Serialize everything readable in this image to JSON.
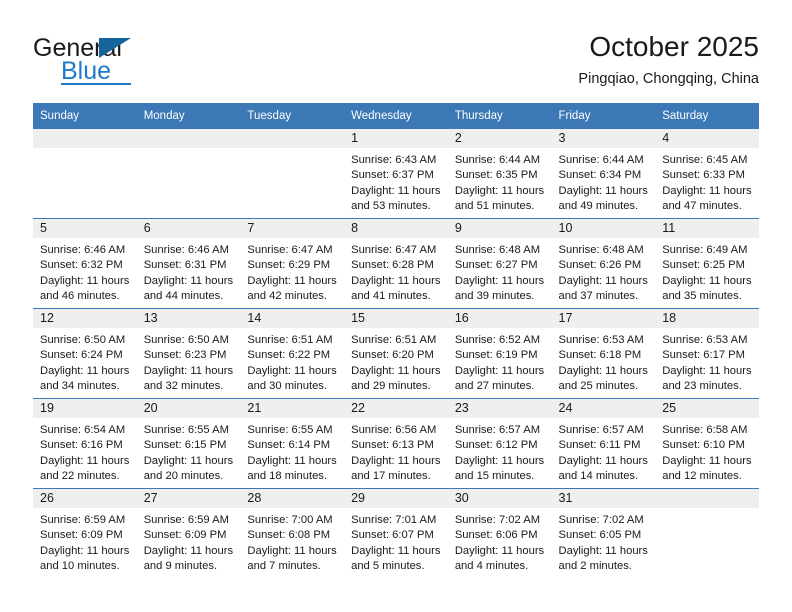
{
  "logo": {
    "word1": "General",
    "word2": "Blue",
    "triangle_color": "#16639e",
    "accent_color": "#1f7ac8"
  },
  "header": {
    "title": "October 2025",
    "subtitle": "Pingqiao, Chongqing, China",
    "header_bg": "#3b78b5",
    "daynum_bg": "#efefef"
  },
  "weekday_headers": [
    "Sunday",
    "Monday",
    "Tuesday",
    "Wednesday",
    "Thursday",
    "Friday",
    "Saturday"
  ],
  "labels": {
    "sunrise_prefix": "Sunrise: ",
    "sunset_prefix": "Sunset: ",
    "daylight_prefix": "Daylight: "
  },
  "weeks": [
    [
      {
        "day": "",
        "sunrise": "",
        "sunset": "",
        "daylight": "",
        "empty": true
      },
      {
        "day": "",
        "sunrise": "",
        "sunset": "",
        "daylight": "",
        "empty": true
      },
      {
        "day": "",
        "sunrise": "",
        "sunset": "",
        "daylight": "",
        "empty": true
      },
      {
        "day": "1",
        "sunrise": "Sunrise: 6:43 AM",
        "sunset": "Sunset: 6:37 PM",
        "daylight": "Daylight: 11 hours and 53 minutes.",
        "empty": false
      },
      {
        "day": "2",
        "sunrise": "Sunrise: 6:44 AM",
        "sunset": "Sunset: 6:35 PM",
        "daylight": "Daylight: 11 hours and 51 minutes.",
        "empty": false
      },
      {
        "day": "3",
        "sunrise": "Sunrise: 6:44 AM",
        "sunset": "Sunset: 6:34 PM",
        "daylight": "Daylight: 11 hours and 49 minutes.",
        "empty": false
      },
      {
        "day": "4",
        "sunrise": "Sunrise: 6:45 AM",
        "sunset": "Sunset: 6:33 PM",
        "daylight": "Daylight: 11 hours and 47 minutes.",
        "empty": false
      }
    ],
    [
      {
        "day": "5",
        "sunrise": "Sunrise: 6:46 AM",
        "sunset": "Sunset: 6:32 PM",
        "daylight": "Daylight: 11 hours and 46 minutes.",
        "empty": false
      },
      {
        "day": "6",
        "sunrise": "Sunrise: 6:46 AM",
        "sunset": "Sunset: 6:31 PM",
        "daylight": "Daylight: 11 hours and 44 minutes.",
        "empty": false
      },
      {
        "day": "7",
        "sunrise": "Sunrise: 6:47 AM",
        "sunset": "Sunset: 6:29 PM",
        "daylight": "Daylight: 11 hours and 42 minutes.",
        "empty": false
      },
      {
        "day": "8",
        "sunrise": "Sunrise: 6:47 AM",
        "sunset": "Sunset: 6:28 PM",
        "daylight": "Daylight: 11 hours and 41 minutes.",
        "empty": false
      },
      {
        "day": "9",
        "sunrise": "Sunrise: 6:48 AM",
        "sunset": "Sunset: 6:27 PM",
        "daylight": "Daylight: 11 hours and 39 minutes.",
        "empty": false
      },
      {
        "day": "10",
        "sunrise": "Sunrise: 6:48 AM",
        "sunset": "Sunset: 6:26 PM",
        "daylight": "Daylight: 11 hours and 37 minutes.",
        "empty": false
      },
      {
        "day": "11",
        "sunrise": "Sunrise: 6:49 AM",
        "sunset": "Sunset: 6:25 PM",
        "daylight": "Daylight: 11 hours and 35 minutes.",
        "empty": false
      }
    ],
    [
      {
        "day": "12",
        "sunrise": "Sunrise: 6:50 AM",
        "sunset": "Sunset: 6:24 PM",
        "daylight": "Daylight: 11 hours and 34 minutes.",
        "empty": false
      },
      {
        "day": "13",
        "sunrise": "Sunrise: 6:50 AM",
        "sunset": "Sunset: 6:23 PM",
        "daylight": "Daylight: 11 hours and 32 minutes.",
        "empty": false
      },
      {
        "day": "14",
        "sunrise": "Sunrise: 6:51 AM",
        "sunset": "Sunset: 6:22 PM",
        "daylight": "Daylight: 11 hours and 30 minutes.",
        "empty": false
      },
      {
        "day": "15",
        "sunrise": "Sunrise: 6:51 AM",
        "sunset": "Sunset: 6:20 PM",
        "daylight": "Daylight: 11 hours and 29 minutes.",
        "empty": false
      },
      {
        "day": "16",
        "sunrise": "Sunrise: 6:52 AM",
        "sunset": "Sunset: 6:19 PM",
        "daylight": "Daylight: 11 hours and 27 minutes.",
        "empty": false
      },
      {
        "day": "17",
        "sunrise": "Sunrise: 6:53 AM",
        "sunset": "Sunset: 6:18 PM",
        "daylight": "Daylight: 11 hours and 25 minutes.",
        "empty": false
      },
      {
        "day": "18",
        "sunrise": "Sunrise: 6:53 AM",
        "sunset": "Sunset: 6:17 PM",
        "daylight": "Daylight: 11 hours and 23 minutes.",
        "empty": false
      }
    ],
    [
      {
        "day": "19",
        "sunrise": "Sunrise: 6:54 AM",
        "sunset": "Sunset: 6:16 PM",
        "daylight": "Daylight: 11 hours and 22 minutes.",
        "empty": false
      },
      {
        "day": "20",
        "sunrise": "Sunrise: 6:55 AM",
        "sunset": "Sunset: 6:15 PM",
        "daylight": "Daylight: 11 hours and 20 minutes.",
        "empty": false
      },
      {
        "day": "21",
        "sunrise": "Sunrise: 6:55 AM",
        "sunset": "Sunset: 6:14 PM",
        "daylight": "Daylight: 11 hours and 18 minutes.",
        "empty": false
      },
      {
        "day": "22",
        "sunrise": "Sunrise: 6:56 AM",
        "sunset": "Sunset: 6:13 PM",
        "daylight": "Daylight: 11 hours and 17 minutes.",
        "empty": false
      },
      {
        "day": "23",
        "sunrise": "Sunrise: 6:57 AM",
        "sunset": "Sunset: 6:12 PM",
        "daylight": "Daylight: 11 hours and 15 minutes.",
        "empty": false
      },
      {
        "day": "24",
        "sunrise": "Sunrise: 6:57 AM",
        "sunset": "Sunset: 6:11 PM",
        "daylight": "Daylight: 11 hours and 14 minutes.",
        "empty": false
      },
      {
        "day": "25",
        "sunrise": "Sunrise: 6:58 AM",
        "sunset": "Sunset: 6:10 PM",
        "daylight": "Daylight: 11 hours and 12 minutes.",
        "empty": false
      }
    ],
    [
      {
        "day": "26",
        "sunrise": "Sunrise: 6:59 AM",
        "sunset": "Sunset: 6:09 PM",
        "daylight": "Daylight: 11 hours and 10 minutes.",
        "empty": false
      },
      {
        "day": "27",
        "sunrise": "Sunrise: 6:59 AM",
        "sunset": "Sunset: 6:09 PM",
        "daylight": "Daylight: 11 hours and 9 minutes.",
        "empty": false
      },
      {
        "day": "28",
        "sunrise": "Sunrise: 7:00 AM",
        "sunset": "Sunset: 6:08 PM",
        "daylight": "Daylight: 11 hours and 7 minutes.",
        "empty": false
      },
      {
        "day": "29",
        "sunrise": "Sunrise: 7:01 AM",
        "sunset": "Sunset: 6:07 PM",
        "daylight": "Daylight: 11 hours and 5 minutes.",
        "empty": false
      },
      {
        "day": "30",
        "sunrise": "Sunrise: 7:02 AM",
        "sunset": "Sunset: 6:06 PM",
        "daylight": "Daylight: 11 hours and 4 minutes.",
        "empty": false
      },
      {
        "day": "31",
        "sunrise": "Sunrise: 7:02 AM",
        "sunset": "Sunset: 6:05 PM",
        "daylight": "Daylight: 11 hours and 2 minutes.",
        "empty": false
      },
      {
        "day": "",
        "sunrise": "",
        "sunset": "",
        "daylight": "",
        "empty": true
      }
    ]
  ]
}
